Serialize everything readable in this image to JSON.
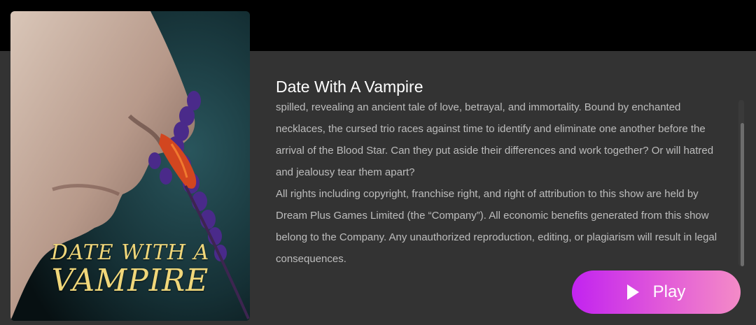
{
  "show": {
    "title": "Date With A Vampire",
    "poster_title_line1": "DATE WITH A",
    "poster_title_line2": "VAMPIRE",
    "description_lines": [
      "spilled, revealing an ancient tale of love, betrayal, and immortality. Bound by enchanted necklaces, the cursed trio races against time to identify and eliminate one another before the arrival of the Blood Star. Can they put aside their differences and work together? Or will hatred and jealousy tear them apart?",
      "All rights including copyright, franchise right, and right of attribution to this show are held by Dream Plus Games Limited (the “Company”). All economic benefits generated from this show belong to the Company. Any unauthorized reproduction, editing, or plagiarism will result in legal consequences."
    ]
  },
  "actions": {
    "play_label": "Play",
    "play_icon": "play-icon"
  },
  "colors": {
    "panel_bg": "#333333",
    "top_bg": "#000000",
    "title_text": "#ffffff",
    "description_text": "#bdbdbd",
    "play_gradient_start": "#c223f0",
    "play_gradient_end": "#f48bc7",
    "poster_title": "#f0d77a"
  }
}
